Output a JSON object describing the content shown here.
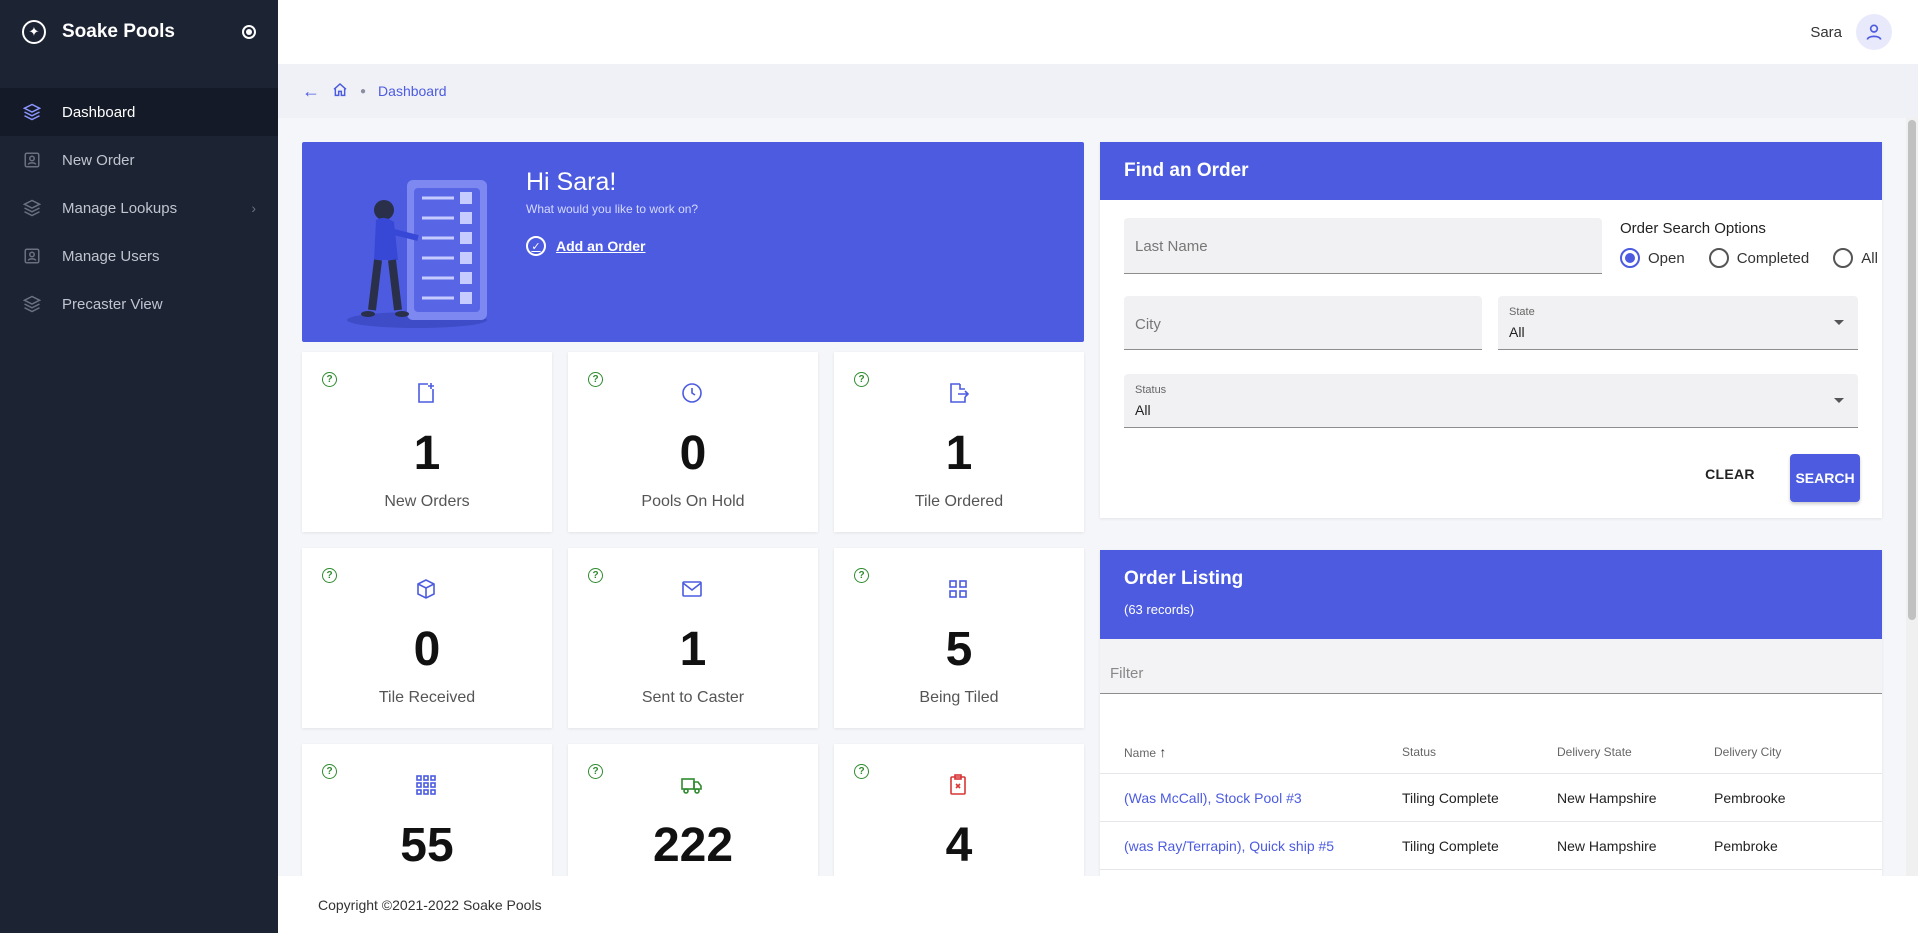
{
  "app": {
    "name": "Soake Pools"
  },
  "sidebar": {
    "items": [
      {
        "label": "Dashboard",
        "icon": "layers-icon",
        "active": true
      },
      {
        "label": "New Order",
        "icon": "contact-card-icon"
      },
      {
        "label": "Manage Lookups",
        "icon": "layers-icon",
        "has_children": true
      },
      {
        "label": "Manage Users",
        "icon": "contact-card-icon"
      },
      {
        "label": "Precaster View",
        "icon": "layers-icon"
      }
    ]
  },
  "topbar": {
    "user": "Sara"
  },
  "breadcrumb": {
    "current": "Dashboard"
  },
  "hero": {
    "greeting": "Hi Sara!",
    "subtitle": "What would you like to work on?",
    "action": "Add an Order"
  },
  "stats": [
    {
      "value": "1",
      "label": "New Orders",
      "icon": "new-document-icon",
      "color": "#4c5be0"
    },
    {
      "value": "0",
      "label": "Pools On Hold",
      "icon": "clock-icon",
      "color": "#4c5be0"
    },
    {
      "value": "1",
      "label": "Tile Ordered",
      "icon": "file-export-icon",
      "color": "#4c5be0"
    },
    {
      "value": "0",
      "label": "Tile Received",
      "icon": "box-received-icon",
      "color": "#4c5be0"
    },
    {
      "value": "1",
      "label": "Sent to Caster",
      "icon": "mail-send-icon",
      "color": "#4c5be0"
    },
    {
      "value": "5",
      "label": "Being Tiled",
      "icon": "tile-grid-icon",
      "color": "#4c5be0"
    },
    {
      "value": "55",
      "label": "",
      "icon": "grid-icon",
      "color": "#4c5be0"
    },
    {
      "value": "222",
      "label": "",
      "icon": "truck-icon",
      "color": "#2e8b2e"
    },
    {
      "value": "4",
      "label": "",
      "icon": "clipboard-x-icon",
      "color": "#d93636"
    }
  ],
  "find": {
    "title": "Find an Order",
    "last_name_placeholder": "Last Name",
    "city_placeholder": "City",
    "state_label": "State",
    "state_value": "All",
    "status_label": "Status",
    "status_value": "All",
    "options_title": "Order Search Options",
    "options": [
      "Open",
      "Completed",
      "All"
    ],
    "selected_option": "Open",
    "clear_label": "CLEAR",
    "search_label": "SEARCH"
  },
  "listing": {
    "title": "Order Listing",
    "count": "(63 records)",
    "filter_placeholder": "Filter",
    "columns": [
      "Name",
      "Status",
      "Delivery State",
      "Delivery City"
    ],
    "sort_indicator": "↑",
    "rows": [
      [
        "(Was McCall), Stock Pool #3",
        "Tiling Complete",
        "New Hampshire",
        "Pembrooke"
      ],
      [
        "(was Ray/Terrapin), Quick ship #5",
        "Tiling Complete",
        "New Hampshire",
        "Pembroke"
      ]
    ]
  },
  "footer": {
    "text": "Copyright ©2021-2022 Soake Pools"
  },
  "colors": {
    "accent": "#4c5be0",
    "sidebar_bg": "#1c2333"
  }
}
